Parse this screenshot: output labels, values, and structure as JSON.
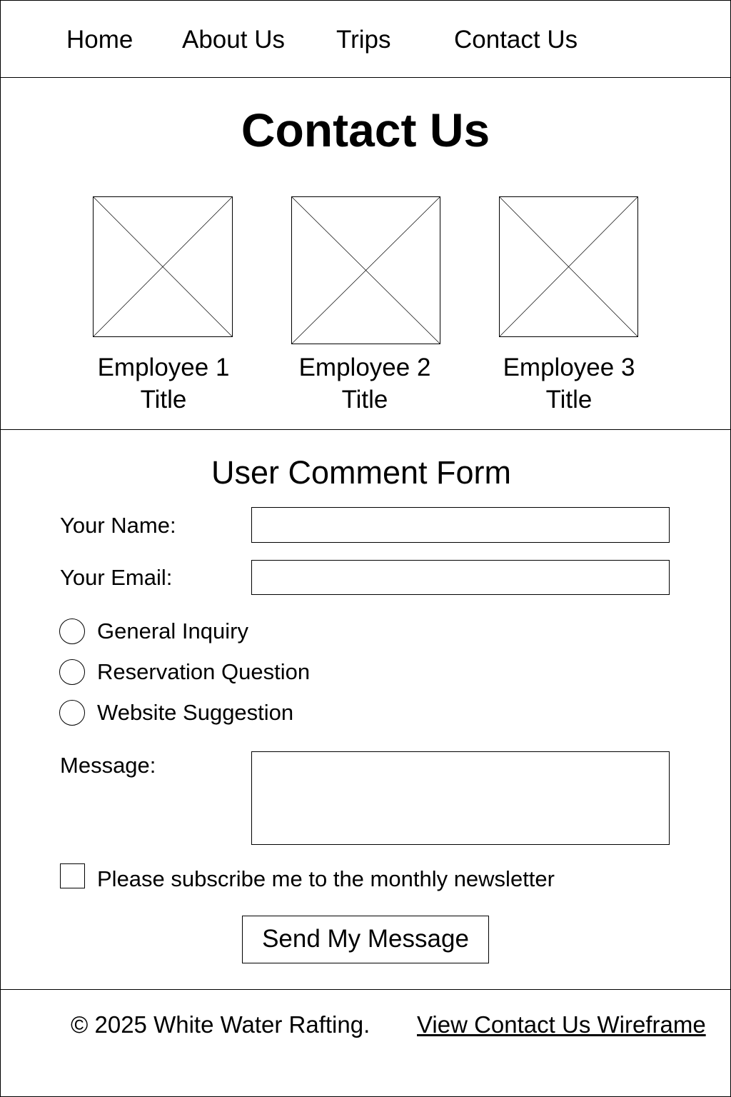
{
  "nav": {
    "items": [
      "Home",
      "About Us",
      "Trips",
      "Contact Us"
    ]
  },
  "page_title": "Contact Us",
  "employees": [
    {
      "name": "Employee 1",
      "title": "Title"
    },
    {
      "name": "Employee 2",
      "title": "Title"
    },
    {
      "name": "Employee 3",
      "title": "Title"
    }
  ],
  "form": {
    "title": "User Comment Form",
    "name_label": "Your Name:",
    "name_value": "",
    "email_label": "Your Email:",
    "email_value": "",
    "options": [
      "General Inquiry",
      "Reservation Question",
      "Website Suggestion"
    ],
    "message_label": "Message:",
    "message_value": "",
    "newsletter_label": "Please subscribe me to the monthly newsletter",
    "submit_label": "Send My Message"
  },
  "footer": {
    "copyright": "© 2025 White Water Rafting.",
    "link": "View Contact Us Wireframe"
  }
}
